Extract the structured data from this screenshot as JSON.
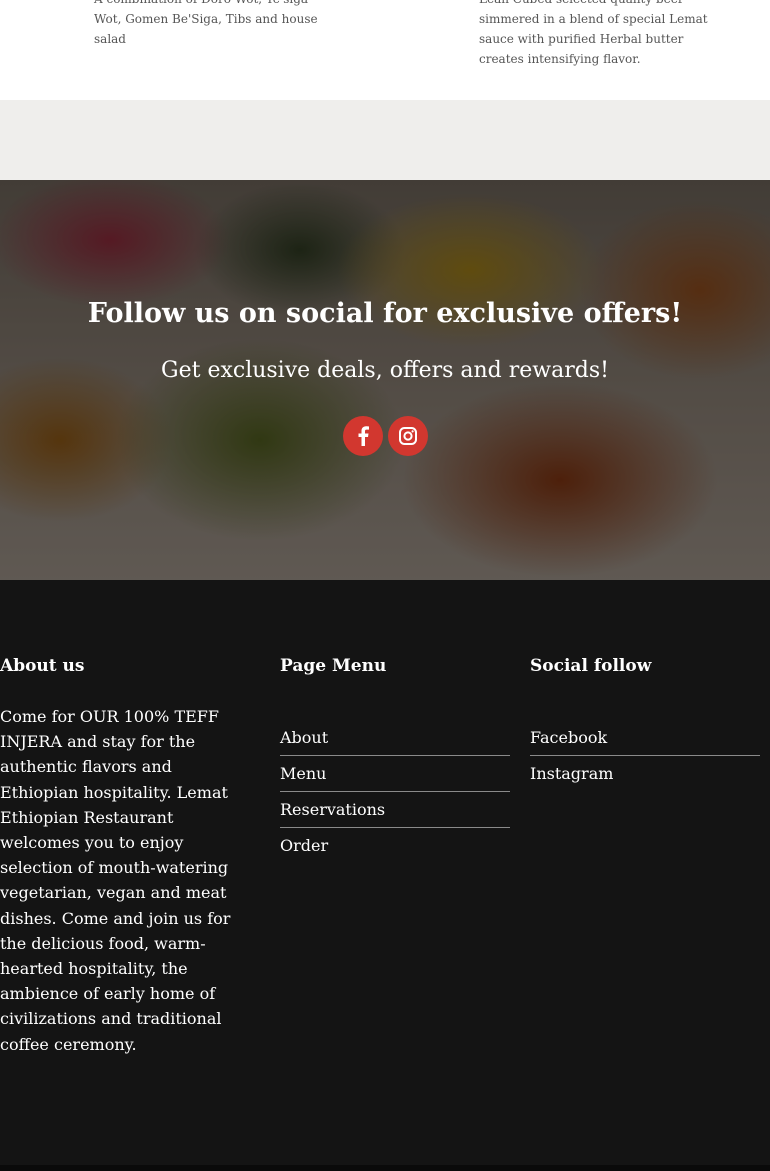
{
  "menu_items": {
    "left_description": "A combination of Doro Wot, Ye'siga Wot, Gomen Be'Siga, Tibs and house salad",
    "right_description": "Lean Cubed selected quality beef simmered in a blend of special Lemat sauce with purified Herbal butter creates intensifying flavor."
  },
  "hero": {
    "title": "Follow us on social for exclusive offers!",
    "subtitle": "Get exclusive deals, offers and rewards!",
    "social_buttons": [
      {
        "icon": "facebook-icon"
      },
      {
        "icon": "instagram-icon"
      }
    ],
    "button_color": "#d2372f"
  },
  "footer": {
    "about": {
      "heading": "About us",
      "text": "Come for OUR 100% TEFF INJERA and stay for the authentic flavors and Ethiopian hospitality. Lemat Ethiopian Restaurant welcomes you to enjoy selection of mouth-watering vegetarian, vegan and meat dishes. Come and join us for the delicious food, warm-hearted hospitality, the ambience of early home of civilizations and traditional coffee ceremony."
    },
    "page_menu": {
      "heading": "Page Menu",
      "links": [
        "About",
        "Menu",
        "Reservations",
        "Order"
      ]
    },
    "social_follow": {
      "heading": "Social follow",
      "links": [
        "Facebook",
        "Instagram"
      ]
    }
  }
}
